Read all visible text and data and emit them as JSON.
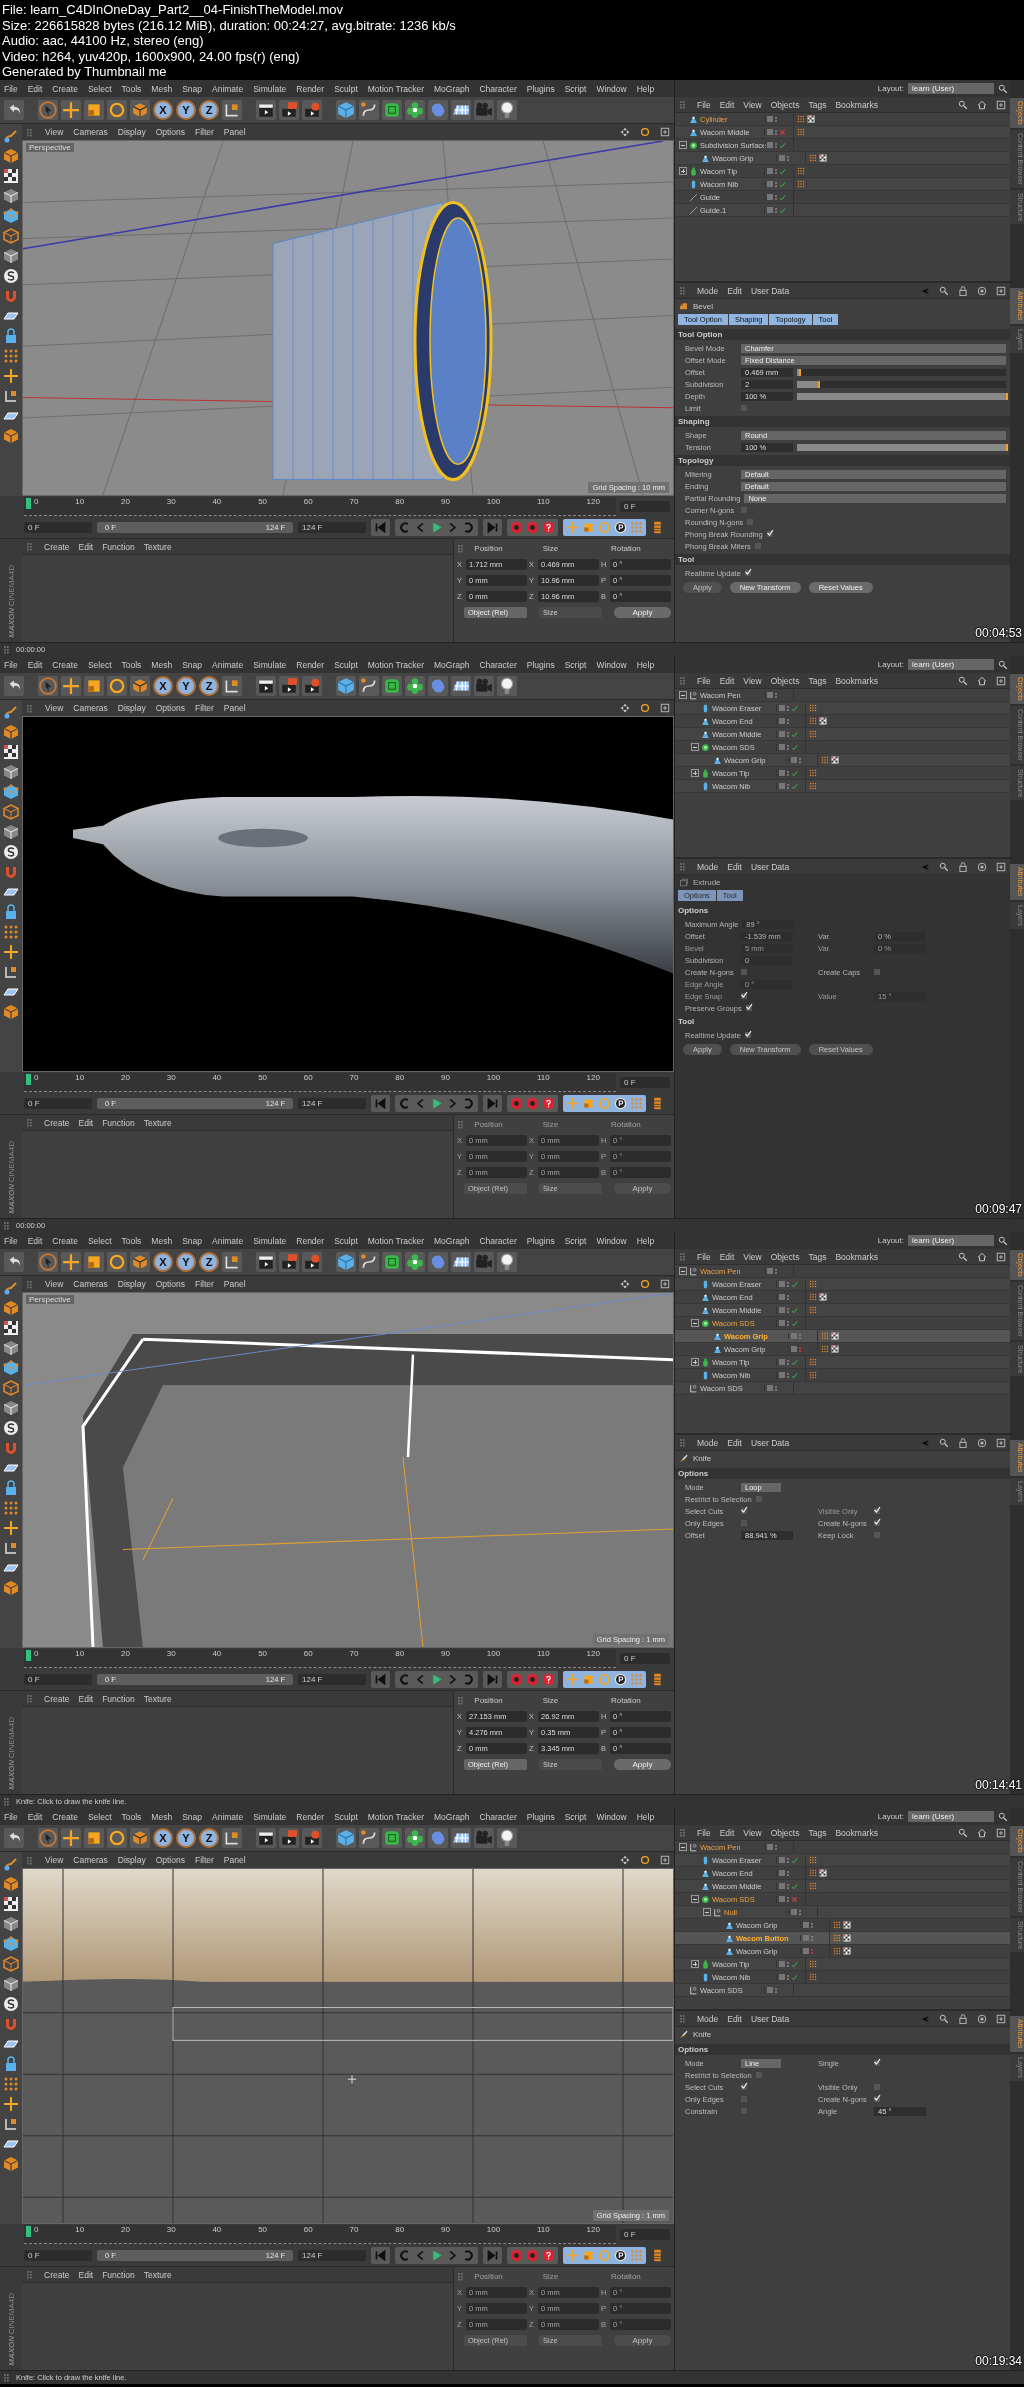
{
  "header": [
    "File: learn_C4DInOneDay_Part2__04-FinishTheModel.mov",
    "Size: 226615828 bytes (216.12 MiB), duration: 00:24:27, avg.bitrate: 1236 kb/s",
    "Audio: aac, 44100 Hz, stereo (eng)",
    "Video: h264, yuv420p, 1600x900, 24.00 fps(r) (eng)",
    "Generated by Thumbnail me"
  ],
  "frames": [
    {
      "timestamp": "00:04:53",
      "menu": [
        "File",
        "Edit",
        "Create",
        "Select",
        "Tools",
        "Mesh",
        "Snap",
        "Animate",
        "Simulate",
        "Render",
        "Sculpt",
        "Motion Tracker",
        "MoGraph",
        "Character",
        "Plugins",
        "Script",
        "Window",
        "Help"
      ],
      "axis_buttons": [
        "X",
        "Y",
        "Z"
      ],
      "viewport": {
        "menu": [
          "View",
          "Cameras",
          "Display",
          "Options",
          "Filter",
          "Panel"
        ],
        "label": "Perspective",
        "kind": "wheel",
        "grid_spacing": "Grid Spacing : 10 mm"
      },
      "layout": {
        "label": "Layout:",
        "value": "learn (User)"
      },
      "side_tabs_top": [
        "Objects",
        "Content Browser",
        "Structure"
      ],
      "side_tabs_bottom": [
        "Attributes",
        "Layers"
      ],
      "objects": {
        "menu": [
          "File",
          "Edit",
          "View",
          "Objects",
          "Tags",
          "Bookmarks"
        ],
        "items": [
          {
            "name": "Cylinder",
            "kind": "cone",
            "checked": false,
            "crossed": false,
            "red_dots": false,
            "tags": [
              {
                "kind": "phong"
              },
              {
                "kind": "checker"
              }
            ],
            "selected": true,
            "active": false
          },
          {
            "name": "Wacom Middle",
            "kind": "cone",
            "checked": false,
            "crossed": true,
            "red_dots": false,
            "tags": [
              {
                "kind": "phong"
              }
            ],
            "selected": false,
            "active": false
          },
          {
            "name": "Subdivision Surface",
            "kind": "sds",
            "checked": true,
            "crossed": false,
            "red_dots": false,
            "selected": false,
            "active": false,
            "expanded": true,
            "children": [
              {
                "name": "Wacom Grip",
                "kind": "cone",
                "checked": false,
                "crossed": false,
                "red_dots": false,
                "tags": [
                  {
                    "kind": "phong"
                  },
                  {
                    "kind": "checker"
                  }
                ],
                "selected": false,
                "active": false
              }
            ]
          },
          {
            "name": "Wacom Tip",
            "kind": "bottle",
            "checked": true,
            "crossed": false,
            "red_dots": false,
            "tags": [
              {
                "kind": "phong"
              }
            ],
            "selected": false,
            "active": false,
            "expanded": false
          },
          {
            "name": "Wacom Nib",
            "kind": "capsule",
            "checked": true,
            "crossed": false,
            "red_dots": false,
            "tags": [
              {
                "kind": "phong"
              }
            ],
            "selected": false,
            "active": false
          },
          {
            "name": "Guide",
            "kind": "guide",
            "checked": true,
            "crossed": false,
            "red_dots": false,
            "selected": false,
            "active": false
          },
          {
            "name": "Guide.1",
            "kind": "guide",
            "checked": true,
            "crossed": false,
            "red_dots": false,
            "selected": false,
            "active": false
          }
        ]
      },
      "attributes": {
        "menu": [
          "Mode",
          "Edit",
          "User Data"
        ],
        "tool": "Bevel",
        "kind": "bevel",
        "disabled": false,
        "tabs": [
          {
            "label": "Tool Option",
            "selected": true
          },
          {
            "label": "Shaping",
            "selected": true
          },
          {
            "label": "Topology",
            "selected": true
          },
          {
            "label": "Tool",
            "selected": true
          }
        ],
        "sections": [
          {
            "title": "Tool Option",
            "rows": [
              [
                {
                  "kind": "dropdown",
                  "label": "Bevel Mode",
                  "value": "Chamfer",
                  "disabled": false
                }
              ],
              [
                {
                  "kind": "dropdown",
                  "label": "Offset Mode",
                  "value": "Fixed Distance",
                  "disabled": false
                }
              ],
              [
                {
                  "kind": "slider",
                  "label": "Offset",
                  "value": "0.469 mm",
                  "level": 0.01,
                  "disabled": false
                }
              ],
              [
                {
                  "kind": "slider",
                  "label": "Subdivision",
                  "value": "2",
                  "level": 0.1,
                  "disabled": false
                }
              ],
              [
                {
                  "kind": "slider",
                  "label": "Depth",
                  "value": "100 %",
                  "level": 1,
                  "disabled": false
                }
              ],
              [
                {
                  "kind": "checkbox",
                  "label": "Limit",
                  "checked": false,
                  "disabled": false
                }
              ]
            ]
          },
          {
            "title": "Shaping",
            "rows": [
              [
                {
                  "kind": "dropdown",
                  "label": "Shape",
                  "value": "Round",
                  "disabled": false
                }
              ],
              [
                {
                  "kind": "slider",
                  "label": "Tension",
                  "value": "100 %",
                  "level": 1,
                  "disabled": false
                }
              ]
            ]
          },
          {
            "title": "Topology",
            "rows": [
              [
                {
                  "kind": "dropdown",
                  "label": "Mitering",
                  "value": "Default",
                  "disabled": false
                }
              ],
              [
                {
                  "kind": "dropdown",
                  "label": "Ending",
                  "value": "Default",
                  "disabled": false
                }
              ],
              [
                {
                  "kind": "dropdown",
                  "label": "Partial Rounding",
                  "value": "None",
                  "disabled": false
                }
              ],
              [
                {
                  "kind": "checkbox",
                  "label": "Corner N-gons",
                  "checked": false,
                  "disabled": false
                }
              ],
              [
                {
                  "kind": "checkbox",
                  "label": "Rounding N-gons",
                  "checked": false,
                  "disabled": false
                }
              ],
              [
                {
                  "kind": "checkbox",
                  "label": "Phong Break Rounding",
                  "checked": true,
                  "disabled": false
                }
              ],
              [
                {
                  "kind": "checkbox",
                  "label": "Phong Break Miters",
                  "checked": false,
                  "disabled": false
                }
              ]
            ]
          },
          {
            "title": "Tool",
            "rows": [
              [
                {
                  "kind": "checkbox",
                  "label": "Realtime Update",
                  "checked": true,
                  "disabled": false
                }
              ]
            ]
          }
        ],
        "buttons": [
          {
            "label": "Apply",
            "disabled": true
          },
          {
            "label": "New Transform",
            "disabled": false
          },
          {
            "label": "Reset Values",
            "disabled": false
          }
        ]
      },
      "timeline": {
        "ticks": [
          "0",
          "10",
          "20",
          "30",
          "40",
          "50",
          "60",
          "70",
          "80",
          "90",
          "100",
          "110",
          "120"
        ],
        "current": "0 F",
        "start": "0 F",
        "range": {
          "start": "0 F",
          "end": "124 F",
          "level": 1
        },
        "end": "124 F"
      },
      "materials": {
        "menu": [
          "Create",
          "Edit",
          "Function",
          "Texture"
        ]
      },
      "logo": [
        "MAXON",
        "CINEMA4D"
      ],
      "coords": {
        "headers": [
          "Position",
          "Size",
          "Rotation"
        ],
        "disabled": false,
        "rows": [
          {
            "axis": "X",
            "position": "1.712 mm",
            "size_axis": "X",
            "size": "0.469 mm",
            "rot_axis": "H",
            "rotation": "0 °"
          },
          {
            "axis": "Y",
            "position": "0 mm",
            "size_axis": "Y",
            "size": "10.96 mm",
            "rot_axis": "P",
            "rotation": "0 °"
          },
          {
            "axis": "Z",
            "position": "0 mm",
            "size_axis": "Z",
            "size": "10.96 mm",
            "rot_axis": "B",
            "rotation": "0 °"
          }
        ],
        "mode": "Object (Rel)",
        "size_mode": "Size",
        "apply": "Apply"
      },
      "status": "00:00:00"
    },
    {
      "timestamp": "00:09:47",
      "menu": [
        "File",
        "Edit",
        "Create",
        "Select",
        "Tools",
        "Mesh",
        "Snap",
        "Animate",
        "Simulate",
        "Render",
        "Sculpt",
        "Motion Tracker",
        "MoGraph",
        "Character",
        "Plugins",
        "Script",
        "Window",
        "Help"
      ],
      "axis_buttons": [
        "X",
        "Y",
        "Z"
      ],
      "viewport": {
        "menu": [
          "View",
          "Cameras",
          "Display",
          "Options",
          "Filter",
          "Panel"
        ],
        "kind": "pen"
      },
      "layout": {
        "label": "Layout:",
        "value": "learn (User)"
      },
      "side_tabs_top": [
        "Objects",
        "Content Browser",
        "Structure"
      ],
      "side_tabs_bottom": [
        "Attributes",
        "Layers"
      ],
      "objects": {
        "menu": [
          "File",
          "Edit",
          "View",
          "Objects",
          "Tags",
          "Bookmarks"
        ],
        "items": [
          {
            "name": "Wacom Pen",
            "kind": "null",
            "checked": false,
            "crossed": false,
            "red_dots": false,
            "selected": false,
            "active": false,
            "expanded": true,
            "children": [
              {
                "name": "Wacom Eraser",
                "kind": "capsule",
                "checked": true,
                "crossed": false,
                "red_dots": false,
                "tags": [
                  {
                    "kind": "phong"
                  }
                ],
                "selected": false,
                "active": false
              },
              {
                "name": "Wacom End",
                "kind": "cone",
                "checked": false,
                "crossed": false,
                "red_dots": false,
                "tags": [
                  {
                    "kind": "phong"
                  },
                  {
                    "kind": "checker"
                  }
                ],
                "selected": false,
                "active": false
              },
              {
                "name": "Wacom Middle",
                "kind": "cone",
                "checked": true,
                "crossed": false,
                "red_dots": false,
                "tags": [
                  {
                    "kind": "phong"
                  }
                ],
                "selected": false,
                "active": false
              },
              {
                "name": "Wacom SDS",
                "kind": "sds",
                "checked": true,
                "crossed": false,
                "red_dots": false,
                "selected": false,
                "active": false,
                "expanded": true,
                "children": [
                  {
                    "name": "Wacom Grip",
                    "kind": "cone",
                    "checked": false,
                    "crossed": false,
                    "red_dots": false,
                    "tags": [
                      {
                        "kind": "phong"
                      },
                      {
                        "kind": "checker"
                      }
                    ],
                    "selected": false,
                    "active": false
                  }
                ]
              },
              {
                "name": "Wacom Tip",
                "kind": "bottle",
                "checked": true,
                "crossed": false,
                "red_dots": false,
                "tags": [
                  {
                    "kind": "phong"
                  }
                ],
                "selected": false,
                "active": false,
                "expanded": false
              },
              {
                "name": "Wacom Nib",
                "kind": "capsule",
                "checked": true,
                "crossed": false,
                "red_dots": false,
                "tags": [
                  {
                    "kind": "phong"
                  }
                ],
                "selected": false,
                "active": false
              }
            ]
          }
        ]
      },
      "attributes": {
        "menu": [
          "Mode",
          "Edit",
          "User Data"
        ],
        "tool": "Extrude",
        "kind": "extrude",
        "disabled": true,
        "tabs": [
          {
            "label": "Options",
            "selected": true
          },
          {
            "label": "Tool",
            "selected": true
          }
        ],
        "sections": [
          {
            "title": "Options",
            "rows": [
              [
                {
                  "kind": "number",
                  "label": "Maximum Angle",
                  "value": "89 °",
                  "disabled": false
                }
              ],
              [
                {
                  "kind": "number",
                  "label": "Offset",
                  "value": "-1.539 mm",
                  "disabled": false
                },
                {
                  "kind": "number",
                  "label": "Var.",
                  "value": "0 %",
                  "disabled": false
                }
              ],
              [
                {
                  "kind": "number",
                  "label": "Bevel",
                  "value": "5 mm",
                  "disabled": true
                },
                {
                  "kind": "number",
                  "label": "Var.",
                  "value": "0 %",
                  "disabled": true
                }
              ],
              [
                {
                  "kind": "number",
                  "label": "Subdivision",
                  "value": "0",
                  "disabled": false
                }
              ],
              [
                {
                  "kind": "checkbox",
                  "label": "Create N-gons",
                  "checked": false,
                  "disabled": false
                },
                {
                  "kind": "checkbox",
                  "label": "Create Caps",
                  "checked": false,
                  "disabled": false
                }
              ],
              [
                {
                  "kind": "number",
                  "label": "Edge Angle",
                  "value": "0 °",
                  "disabled": true
                }
              ],
              [
                {
                  "kind": "checkbox",
                  "label": "Edge Snap",
                  "checked": true,
                  "disabled": true
                },
                {
                  "kind": "number",
                  "label": "Value",
                  "value": "15 °",
                  "disabled": true
                }
              ],
              [
                {
                  "kind": "checkbox",
                  "label": "Preserve Groups",
                  "checked": true,
                  "disabled": false
                }
              ]
            ]
          },
          {
            "title": "Tool",
            "rows": [
              [
                {
                  "kind": "checkbox",
                  "label": "Realtime Update",
                  "checked": true,
                  "disabled": false
                }
              ]
            ]
          }
        ],
        "buttons": [
          {
            "label": "Apply",
            "disabled": true
          },
          {
            "label": "New Transform",
            "disabled": true
          },
          {
            "label": "Reset Values",
            "disabled": true
          }
        ]
      },
      "timeline": {
        "ticks": [
          "0",
          "10",
          "20",
          "30",
          "40",
          "50",
          "60",
          "70",
          "80",
          "90",
          "100",
          "110",
          "120"
        ],
        "current": "0 F",
        "start": "0 F",
        "range": {
          "start": "0 F",
          "end": "124 F",
          "level": 1
        },
        "end": "124 F"
      },
      "materials": {
        "menu": [
          "Create",
          "Edit",
          "Function",
          "Texture"
        ]
      },
      "logo": [
        "MAXON",
        "CINEMA4D"
      ],
      "coords": {
        "headers": [
          "Position",
          "Size",
          "Rotation"
        ],
        "disabled": true,
        "rows": [
          {
            "axis": "X",
            "position": "0 mm",
            "size_axis": "X",
            "size": "0 mm",
            "rot_axis": "H",
            "rotation": "0 °"
          },
          {
            "axis": "Y",
            "position": "0 mm",
            "size_axis": "Y",
            "size": "0 mm",
            "rot_axis": "P",
            "rotation": "0 °"
          },
          {
            "axis": "Z",
            "position": "0 mm",
            "size_axis": "Z",
            "size": "0 mm",
            "rot_axis": "B",
            "rotation": "0 °"
          }
        ],
        "mode": "Object (Rel)",
        "size_mode": "Size",
        "apply": "Apply"
      },
      "status": "00:00:00"
    },
    {
      "timestamp": "00:14:41",
      "menu": [
        "File",
        "Edit",
        "Create",
        "Select",
        "Tools",
        "Mesh",
        "Snap",
        "Animate",
        "Simulate",
        "Render",
        "Sculpt",
        "Motion Tracker",
        "MoGraph",
        "Character",
        "Plugins",
        "Script",
        "Window",
        "Help"
      ],
      "axis_buttons": [
        "X",
        "Y",
        "Z"
      ],
      "viewport": {
        "menu": [
          "View",
          "Cameras",
          "Display",
          "Options",
          "Filter",
          "Panel"
        ],
        "label": "Perspective",
        "kind": "corner",
        "grid_spacing": "Grid Spacing : 1 mm"
      },
      "layout": {
        "label": "Layout:",
        "value": "learn (User)"
      },
      "side_tabs_top": [
        "Objects",
        "Content Browser",
        "Structure"
      ],
      "side_tabs_bottom": [
        "Attributes",
        "Layers"
      ],
      "objects": {
        "menu": [
          "File",
          "Edit",
          "View",
          "Objects",
          "Tags",
          "Bookmarks"
        ],
        "items": [
          {
            "name": "Wacom Pen",
            "kind": "null",
            "checked": false,
            "crossed": false,
            "red_dots": false,
            "selected": true,
            "active": false,
            "expanded": true,
            "children": [
              {
                "name": "Wacom Eraser",
                "kind": "capsule",
                "checked": true,
                "crossed": false,
                "red_dots": false,
                "tags": [
                  {
                    "kind": "phong"
                  }
                ],
                "selected": false,
                "active": false
              },
              {
                "name": "Wacom End",
                "kind": "cone",
                "checked": false,
                "crossed": false,
                "red_dots": false,
                "tags": [
                  {
                    "kind": "phong"
                  },
                  {
                    "kind": "checker"
                  }
                ],
                "selected": false,
                "active": false
              },
              {
                "name": "Wacom Middle",
                "kind": "cone",
                "checked": true,
                "crossed": false,
                "red_dots": false,
                "tags": [
                  {
                    "kind": "phong"
                  }
                ],
                "selected": false,
                "active": false
              },
              {
                "name": "Wacom SDS",
                "kind": "sds",
                "checked": true,
                "crossed": false,
                "red_dots": false,
                "selected": true,
                "active": false,
                "expanded": true,
                "children": [
                  {
                    "name": "Wacom Grip",
                    "kind": "cone",
                    "checked": false,
                    "crossed": false,
                    "red_dots": false,
                    "tags": [
                      {
                        "kind": "phong"
                      },
                      {
                        "kind": "checker"
                      }
                    ],
                    "selected": true,
                    "active": true
                  },
                  {
                    "name": "Wacom Grip",
                    "kind": "cone",
                    "checked": false,
                    "crossed": false,
                    "red_dots": true,
                    "tags": [
                      {
                        "kind": "phong"
                      },
                      {
                        "kind": "checker"
                      }
                    ],
                    "selected": false,
                    "active": false
                  }
                ]
              },
              {
                "name": "Wacom Tip",
                "kind": "bottle",
                "checked": true,
                "crossed": false,
                "red_dots": false,
                "tags": [
                  {
                    "kind": "phong"
                  }
                ],
                "selected": false,
                "active": false,
                "expanded": false
              },
              {
                "name": "Wacom Nib",
                "kind": "capsule",
                "checked": true,
                "crossed": false,
                "red_dots": false,
                "tags": [
                  {
                    "kind": "phong"
                  }
                ],
                "selected": false,
                "active": false
              }
            ]
          },
          {
            "name": "Wacom SDS",
            "kind": "null",
            "checked": false,
            "crossed": false,
            "red_dots": false,
            "selected": false,
            "active": false
          }
        ]
      },
      "attributes": {
        "menu": [
          "Mode",
          "Edit",
          "User Data"
        ],
        "tool": "Knife",
        "kind": "knife",
        "disabled": false,
        "sections": [
          {
            "title": "Options",
            "rows": [
              [
                {
                  "kind": "dropdown",
                  "label": "Mode",
                  "value": "Loop",
                  "disabled": false
                }
              ],
              [
                {
                  "kind": "checkbox",
                  "label": "Restrict to Selection",
                  "checked": false,
                  "disabled": false
                }
              ],
              [
                {
                  "kind": "checkbox",
                  "label": "Select Cuts",
                  "checked": true,
                  "disabled": false
                },
                {
                  "kind": "checkbox",
                  "label": "Visible Only",
                  "checked": true,
                  "disabled": true
                }
              ],
              [
                {
                  "kind": "checkbox",
                  "label": "Only Edges",
                  "checked": false,
                  "disabled": false
                },
                {
                  "kind": "checkbox",
                  "label": "Create N-gons",
                  "checked": true,
                  "disabled": false
                }
              ],
              [
                {
                  "kind": "number",
                  "label": "Offset",
                  "value": "88.941 %",
                  "disabled": false
                },
                {
                  "kind": "checkbox",
                  "label": "Keep Lock",
                  "checked": false,
                  "disabled": false
                }
              ]
            ]
          }
        ]
      },
      "timeline": {
        "ticks": [
          "0",
          "10",
          "20",
          "30",
          "40",
          "50",
          "60",
          "70",
          "80",
          "90",
          "100",
          "110",
          "120"
        ],
        "current": "0 F",
        "start": "0 F",
        "range": {
          "start": "0 F",
          "end": "124 F",
          "level": 1
        },
        "end": "124 F"
      },
      "materials": {
        "menu": [
          "Create",
          "Edit",
          "Function",
          "Texture"
        ]
      },
      "logo": [
        "MAXON",
        "CINEMA4D"
      ],
      "coords": {
        "headers": [
          "Position",
          "Size",
          "Rotation"
        ],
        "disabled": false,
        "rows": [
          {
            "axis": "X",
            "position": "27.153 mm",
            "size_axis": "X",
            "size": "26.92 mm",
            "rot_axis": "H",
            "rotation": "0 °"
          },
          {
            "axis": "Y",
            "position": "4.276 mm",
            "size_axis": "Y",
            "size": "0.35 mm",
            "rot_axis": "P",
            "rotation": "0 °"
          },
          {
            "axis": "Z",
            "position": "0 mm",
            "size_axis": "Z",
            "size": "3.345 mm",
            "rot_axis": "B",
            "rotation": "0 °"
          }
        ],
        "mode": "Object (Rel)",
        "size_mode": "Size",
        "apply": "Apply"
      },
      "status": "Knife: Click to draw the knife line."
    },
    {
      "timestamp": "00:19:34",
      "menu": [
        "File",
        "Edit",
        "Create",
        "Select",
        "Tools",
        "Mesh",
        "Snap",
        "Animate",
        "Simulate",
        "Render",
        "Sculpt",
        "Motion Tracker",
        "MoGraph",
        "Character",
        "Plugins",
        "Script",
        "Window",
        "Help"
      ],
      "axis_buttons": [
        "X",
        "Y",
        "Z"
      ],
      "viewport": {
        "menu": [
          "View",
          "Cameras",
          "Display",
          "Options",
          "Filter",
          "Panel"
        ],
        "kind": "plane",
        "grid_spacing": "Grid Spacing : 1 mm"
      },
      "layout": {
        "label": "Layout:",
        "value": "learn (User)"
      },
      "side_tabs_top": [
        "Objects",
        "Content Browser",
        "Structure"
      ],
      "side_tabs_bottom": [
        "Attributes",
        "Layers"
      ],
      "objects": {
        "menu": [
          "File",
          "Edit",
          "View",
          "Objects",
          "Tags",
          "Bookmarks"
        ],
        "items": [
          {
            "name": "Wacom Pen",
            "kind": "null",
            "checked": false,
            "crossed": false,
            "red_dots": false,
            "selected": true,
            "active": false,
            "expanded": true,
            "children": [
              {
                "name": "Wacom Eraser",
                "kind": "capsule",
                "checked": true,
                "crossed": false,
                "red_dots": false,
                "tags": [
                  {
                    "kind": "phong"
                  }
                ],
                "selected": false,
                "active": false
              },
              {
                "name": "Wacom End",
                "kind": "cone",
                "checked": false,
                "crossed": false,
                "red_dots": false,
                "tags": [
                  {
                    "kind": "phong"
                  },
                  {
                    "kind": "checker"
                  }
                ],
                "selected": false,
                "active": false
              },
              {
                "name": "Wacom Middle",
                "kind": "cone",
                "checked": true,
                "crossed": false,
                "red_dots": false,
                "tags": [
                  {
                    "kind": "phong"
                  }
                ],
                "selected": false,
                "active": false
              },
              {
                "name": "Wacom SDS",
                "kind": "sds",
                "checked": false,
                "crossed": true,
                "red_dots": false,
                "selected": true,
                "active": false,
                "expanded": true,
                "children": [
                  {
                    "name": "Null",
                    "kind": "null",
                    "checked": false,
                    "crossed": false,
                    "red_dots": false,
                    "selected": true,
                    "active": false,
                    "expanded": true,
                    "children": [
                      {
                        "name": "Wacom Grip",
                        "kind": "cone",
                        "checked": false,
                        "crossed": false,
                        "red_dots": false,
                        "tags": [
                          {
                            "kind": "phong"
                          },
                          {
                            "kind": "checker"
                          }
                        ],
                        "selected": false,
                        "active": false
                      },
                      {
                        "name": "Wacom Button",
                        "kind": "cone",
                        "checked": false,
                        "crossed": false,
                        "red_dots": false,
                        "tags": [
                          {
                            "kind": "phong"
                          },
                          {
                            "kind": "checker"
                          }
                        ],
                        "selected": true,
                        "active": true
                      },
                      {
                        "name": "Wacom Grip",
                        "kind": "cone",
                        "checked": false,
                        "crossed": false,
                        "red_dots": true,
                        "tags": [
                          {
                            "kind": "phong"
                          },
                          {
                            "kind": "checker"
                          }
                        ],
                        "selected": false,
                        "active": false
                      }
                    ]
                  }
                ]
              },
              {
                "name": "Wacom Tip",
                "kind": "bottle",
                "checked": true,
                "crossed": false,
                "red_dots": false,
                "tags": [
                  {
                    "kind": "phong"
                  }
                ],
                "selected": false,
                "active": false,
                "expanded": false
              },
              {
                "name": "Wacom Nib",
                "kind": "capsule",
                "checked": true,
                "crossed": false,
                "red_dots": false,
                "tags": [
                  {
                    "kind": "phong"
                  }
                ],
                "selected": false,
                "active": false
              }
            ]
          },
          {
            "name": "Wacom SDS",
            "kind": "null",
            "checked": false,
            "crossed": false,
            "red_dots": false,
            "selected": false,
            "active": false
          }
        ]
      },
      "attributes": {
        "menu": [
          "Mode",
          "Edit",
          "User Data"
        ],
        "tool": "Knife",
        "kind": "knife",
        "disabled": false,
        "sections": [
          {
            "title": "Options",
            "rows": [
              [
                {
                  "kind": "dropdown",
                  "label": "Mode",
                  "value": "Line",
                  "disabled": false
                },
                {
                  "kind": "checkbox",
                  "label": "Single",
                  "checked": true,
                  "disabled": false
                }
              ],
              [
                {
                  "kind": "checkbox",
                  "label": "Restrict to Selection",
                  "checked": false,
                  "disabled": false
                }
              ],
              [
                {
                  "kind": "checkbox",
                  "label": "Select Cuts",
                  "checked": true,
                  "disabled": false
                },
                {
                  "kind": "checkbox",
                  "label": "Visible Only",
                  "checked": false,
                  "disabled": false
                }
              ],
              [
                {
                  "kind": "checkbox",
                  "label": "Only Edges",
                  "checked": false,
                  "disabled": false
                },
                {
                  "kind": "checkbox",
                  "label": "Create N-gons",
                  "checked": true,
                  "disabled": false
                }
              ],
              [
                {
                  "kind": "checkbox",
                  "label": "Constrain",
                  "checked": false,
                  "disabled": false
                },
                {
                  "kind": "number",
                  "label": "Angle",
                  "value": "45 °",
                  "disabled": false
                }
              ]
            ]
          }
        ]
      },
      "timeline": {
        "ticks": [
          "0",
          "10",
          "20",
          "30",
          "40",
          "50",
          "60",
          "70",
          "80",
          "90",
          "100",
          "110",
          "120"
        ],
        "current": "0 F",
        "start": "0 F",
        "range": {
          "start": "0 F",
          "end": "124 F",
          "level": 1
        },
        "end": "124 F"
      },
      "materials": {
        "menu": [
          "Create",
          "Edit",
          "Function",
          "Texture"
        ]
      },
      "logo": [
        "MAXON",
        "CINEMA4D"
      ],
      "coords": {
        "headers": [
          "Position",
          "Size",
          "Rotation"
        ],
        "disabled": true,
        "rows": [
          {
            "axis": "X",
            "position": "0 mm",
            "size_axis": "X",
            "size": "0 mm",
            "rot_axis": "H",
            "rotation": "0 °"
          },
          {
            "axis": "Y",
            "position": "0 mm",
            "size_axis": "Y",
            "size": "0 mm",
            "rot_axis": "P",
            "rotation": "0 °"
          },
          {
            "axis": "Z",
            "position": "0 mm",
            "size_axis": "Z",
            "size": "0 mm",
            "rot_axis": "B",
            "rotation": "0 °"
          }
        ],
        "mode": "Object (Rel)",
        "size_mode": "Size",
        "apply": "Apply"
      },
      "status": "Knife: Click to draw the knife line."
    }
  ]
}
